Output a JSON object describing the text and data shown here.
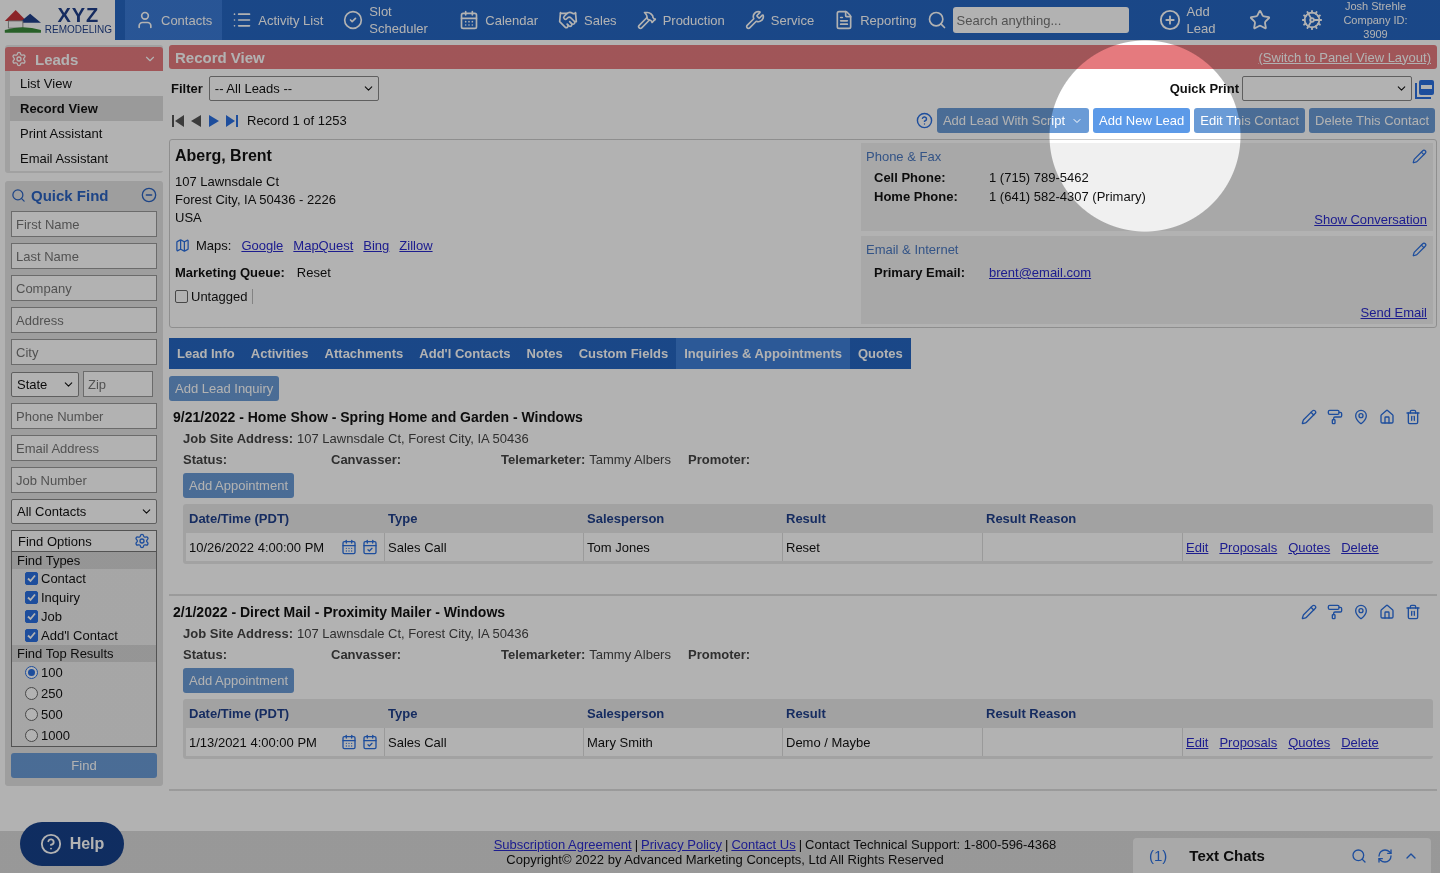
{
  "nav": {
    "logo": {
      "line1": "XYZ",
      "line2": "REMODELING"
    },
    "items": [
      {
        "label": "Contacts",
        "selected": true
      },
      {
        "label": "Activity List",
        "selected": false
      },
      {
        "label": "Slot Scheduler",
        "selected": false
      },
      {
        "label": "Calendar",
        "selected": false
      },
      {
        "label": "Sales",
        "selected": false
      },
      {
        "label": "Production",
        "selected": false
      },
      {
        "label": "Service",
        "selected": false
      },
      {
        "label": "Reporting",
        "selected": false
      }
    ],
    "search": {
      "placeholder": "Search anything..."
    },
    "add_lead": "Add Lead",
    "user": {
      "name": "Josh Strehle",
      "company": "Company ID: 3909"
    }
  },
  "sidebar": {
    "leads": {
      "title": "Leads",
      "items": [
        {
          "label": "List View",
          "selected": false
        },
        {
          "label": "Record View",
          "selected": true
        },
        {
          "label": "Print Assistant",
          "selected": false
        },
        {
          "label": "Email Assistant",
          "selected": false
        }
      ]
    },
    "quick_find": {
      "title": "Quick Find",
      "fields_top": [
        {
          "placeholder": "First Name"
        },
        {
          "placeholder": "Last Name"
        },
        {
          "placeholder": "Company"
        },
        {
          "placeholder": "Address"
        },
        {
          "placeholder": "City"
        }
      ],
      "state": "State",
      "zip": {
        "placeholder": "Zip"
      },
      "fields_bottom": [
        {
          "placeholder": "Phone Number"
        },
        {
          "placeholder": "Email Address"
        },
        {
          "placeholder": "Job Number"
        }
      ],
      "contacts_select": "All Contacts",
      "options_title": "Find Options",
      "types_label": "Find Types",
      "types": [
        {
          "label": "Contact",
          "checked": true
        },
        {
          "label": "Inquiry",
          "checked": true
        },
        {
          "label": "Job",
          "checked": true
        },
        {
          "label": "Add'l Contact",
          "checked": true
        }
      ],
      "results_label": "Find Top Results",
      "results": [
        {
          "label": "100",
          "selected": true
        },
        {
          "label": "250",
          "selected": false
        },
        {
          "label": "500",
          "selected": false
        },
        {
          "label": "1000",
          "selected": false
        }
      ],
      "find_button": "Find"
    }
  },
  "main": {
    "title": "Record View",
    "switch_link": "(Switch to Panel View Layout)",
    "filter_label": "Filter",
    "filter_value": "-- All Leads --",
    "record_text": "Record 1 of 1253",
    "quick_print_label": "Quick Print",
    "buttons": [
      "Add Lead With Script",
      "Add New Lead",
      "Edit This Contact",
      "Delete This Contact"
    ],
    "contact": {
      "name": "Aberg, Brent",
      "address": [
        "107 Lawnsdale Ct",
        "Forest City, IA 50436 - 2226",
        "USA"
      ],
      "maps_label": "Maps:",
      "map_links": [
        "Google",
        "MapQuest",
        "Bing",
        "Zillow"
      ],
      "marketing_label": "Marketing Queue:",
      "marketing_value": "Reset",
      "untagged": {
        "label": "Untagged",
        "checked": false
      }
    },
    "phone_panel": {
      "title": "Phone & Fax",
      "rows": [
        {
          "label": "Cell Phone:",
          "value": "1 (715) 789-5462"
        },
        {
          "label": "Home Phone:",
          "value": "1 (641) 582-4307 (Primary)"
        }
      ],
      "link": "Show Conversation"
    },
    "email_panel": {
      "title": "Email & Internet",
      "rows": [
        {
          "label": "Primary Email:",
          "value": "brent@email.com"
        }
      ],
      "link": "Send Email"
    },
    "tabs": [
      {
        "label": "Lead Info",
        "selected": false
      },
      {
        "label": "Activities",
        "selected": false
      },
      {
        "label": "Attachments",
        "selected": false
      },
      {
        "label": "Add'l Contacts",
        "selected": false
      },
      {
        "label": "Notes",
        "selected": false
      },
      {
        "label": "Custom Fields",
        "selected": false
      },
      {
        "label": "Inquiries & Appointments",
        "selected": true
      },
      {
        "label": "Quotes",
        "selected": false
      }
    ],
    "add_inquiry": "Add Lead Inquiry",
    "inquiries": [
      {
        "title": "9/21/2022 - Home Show - Spring Home and Garden - Windows",
        "address_label": "Job Site Address:",
        "address": "107 Lawnsdale Ct, Forest City, IA 50436",
        "status_label": "Status:",
        "canvasser_label": "Canvasser:",
        "telemarketer_label": "Telemarketer:",
        "telemarketer": "Tammy Albers",
        "promoter_label": "Promoter:",
        "add_button": "Add Appointment",
        "columns": [
          "Date/Time (PDT)",
          "Type",
          "Salesperson",
          "Result",
          "Result Reason"
        ],
        "rows": [
          {
            "date": "10/26/2022 4:00:00 PM",
            "type": "Sales Call",
            "salesperson": "Tom Jones",
            "result": "Reset",
            "actions": [
              "Edit",
              "Proposals",
              "Quotes",
              "Delete"
            ]
          }
        ]
      },
      {
        "title": "2/1/2022 - Direct Mail - Proximity Mailer - Windows",
        "address_label": "Job Site Address:",
        "address": "107 Lawnsdale Ct, Forest City, IA 50436",
        "status_label": "Status:",
        "canvasser_label": "Canvasser:",
        "telemarketer_label": "Telemarketer:",
        "telemarketer": "Tammy Albers",
        "promoter_label": "Promoter:",
        "add_button": "Add Appointment",
        "columns": [
          "Date/Time (PDT)",
          "Type",
          "Salesperson",
          "Result",
          "Result Reason"
        ],
        "rows": [
          {
            "date": "1/13/2021 4:00:00 PM",
            "type": "Sales Call",
            "salesperson": "Mary Smith",
            "result": "Demo / Maybe",
            "actions": [
              "Edit",
              "Proposals",
              "Quotes",
              "Delete"
            ]
          }
        ]
      }
    ]
  },
  "footer": {
    "links": [
      "Subscription Agreement",
      "Privacy Policy",
      "Contact Us"
    ],
    "separator": "|",
    "support": "Contact Technical Support: 1-800-596-4368",
    "copyright": "Copyright© 2022 by Advanced Marketing Concepts, Ltd All Rights Reserved"
  },
  "help": "Help",
  "chat": {
    "count": "(1)",
    "title": "Text Chats"
  }
}
